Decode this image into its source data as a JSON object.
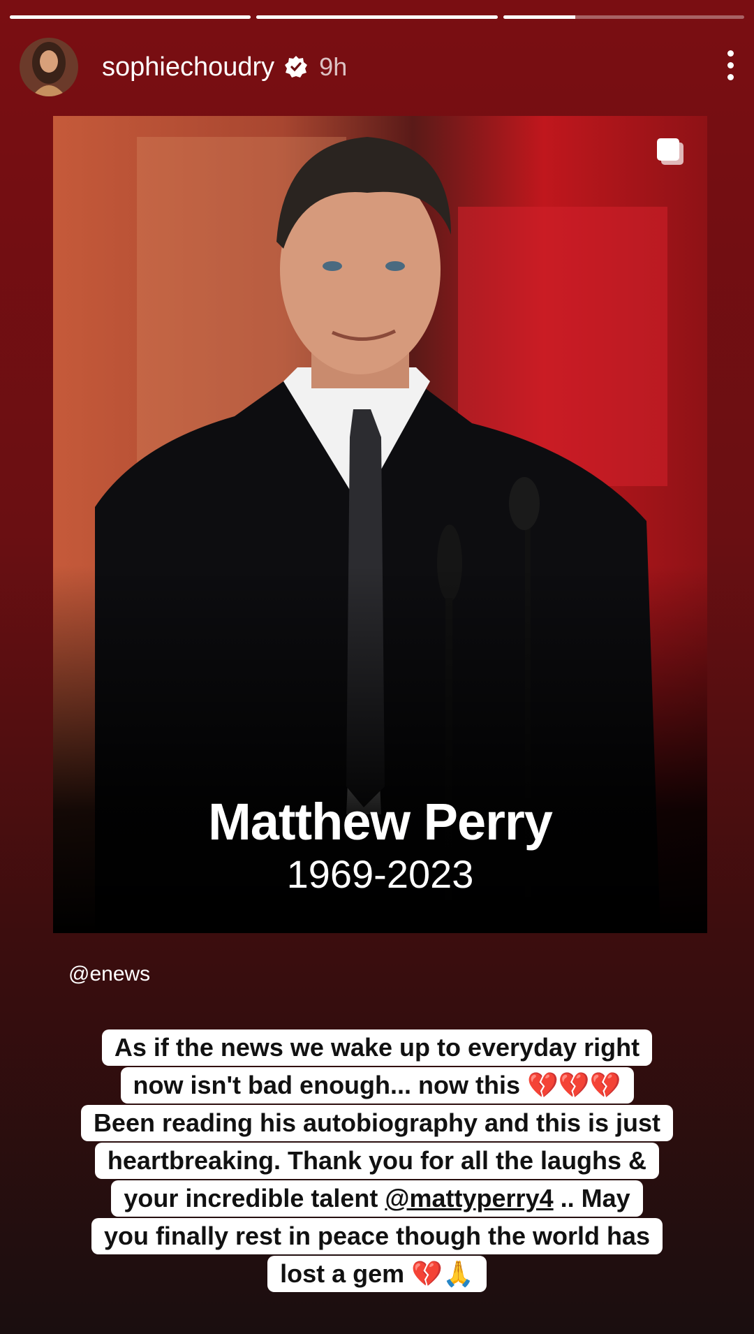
{
  "story": {
    "progress_segments": [
      1,
      1,
      0.3
    ],
    "username": "sophiechoudry",
    "time": "9h"
  },
  "post": {
    "name": "Matthew Perry",
    "years": "1969-2023",
    "source": "@enews"
  },
  "sticker": {
    "lines": [
      "As if the news we wake up to everyday right",
      "now isn't bad enough... now this 💔💔💔",
      "Been reading his autobiography and this is just",
      "heartbreaking. Thank you for all the laughs &",
      "your incredible talent",
      "@mattyperry4",
      ".. May",
      "you finally rest in peace though the world has",
      "lost a gem 💔🙏"
    ]
  },
  "colors": {
    "accent": "#c7182a",
    "bg_top": "#7a0e12",
    "bg_bottom": "#1a0e0f"
  }
}
